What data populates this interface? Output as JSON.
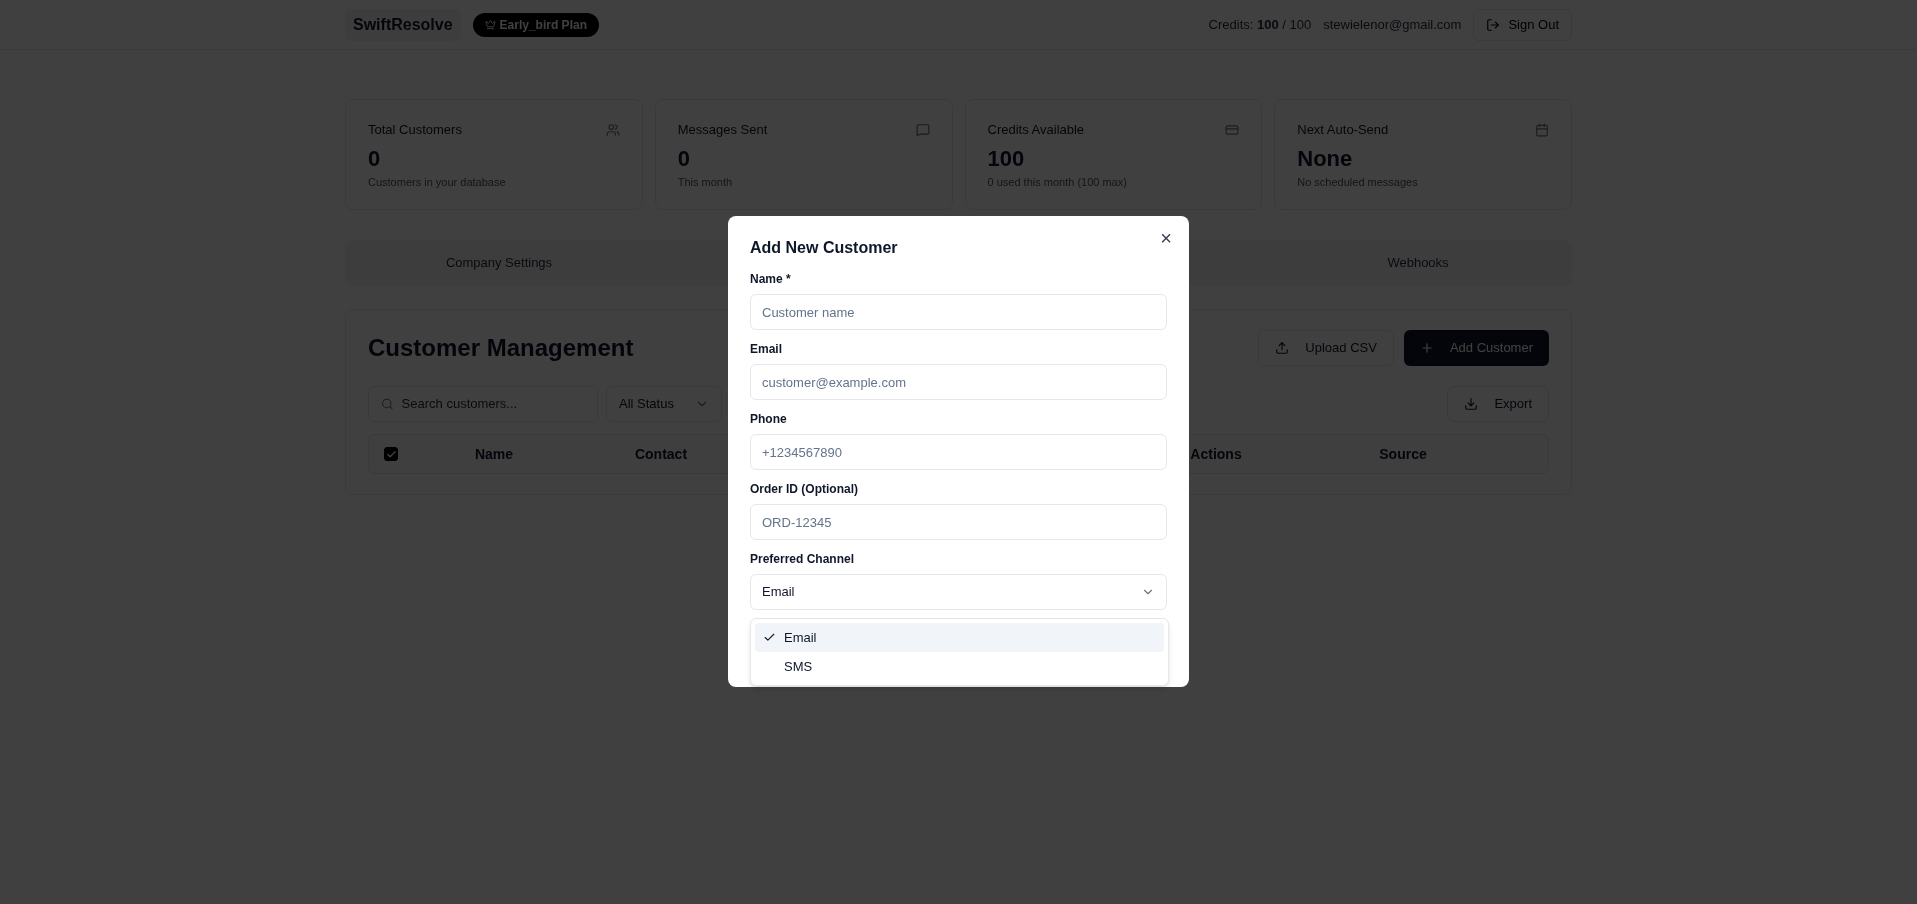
{
  "header": {
    "brand": "SwiftResolve",
    "plan_badge": "Early_bird Plan",
    "credits": "Credits: **100** / 100",
    "email": "stewielenor@gmail.com",
    "sign_out": "Sign Out"
  },
  "stats": [
    {
      "title": "Total Customers",
      "value": "0",
      "note": "Customers in your database"
    },
    {
      "title": "Messages Sent",
      "value": "0",
      "note": "This month"
    },
    {
      "title": "Credits Available",
      "value": "100",
      "note": "0 used this month (100 max)"
    },
    {
      "title": "Next Auto-Send",
      "value": "None",
      "note": "No scheduled messages"
    }
  ],
  "tabs": [
    {
      "label": "Company Settings",
      "selected": false
    },
    {
      "label": "Webhooks",
      "selected": false
    }
  ],
  "customers": {
    "title": "Customer Management",
    "upload_button": "Upload CSV",
    "add_button": "Add Customer",
    "search": {
      "placeholder": "Search customers..."
    },
    "status_filter": "All Status",
    "export_button": "Export",
    "select_all_checked": true,
    "columns": [
      {
        "label": "Name"
      },
      {
        "label": "Contact"
      },
      {},
      {
        "label": "Actions"
      },
      {
        "label": "Source"
      }
    ]
  },
  "dialog": {
    "title": "Add New Customer",
    "close": "×",
    "fields": [
      {
        "label": "Name *",
        "placeholder": "Customer name"
      },
      {
        "label": "Email",
        "placeholder": "customer@example.com"
      },
      {
        "label": "Phone",
        "placeholder": "+1234567890"
      },
      {
        "label": "Order ID (Optional)",
        "placeholder": "ORD-12345"
      }
    ],
    "channel": {
      "label": "Preferred Channel",
      "value": "Email",
      "options": [
        {
          "label": "Email",
          "selected": true
        },
        {
          "label": "SMS",
          "selected": false
        }
      ]
    }
  }
}
